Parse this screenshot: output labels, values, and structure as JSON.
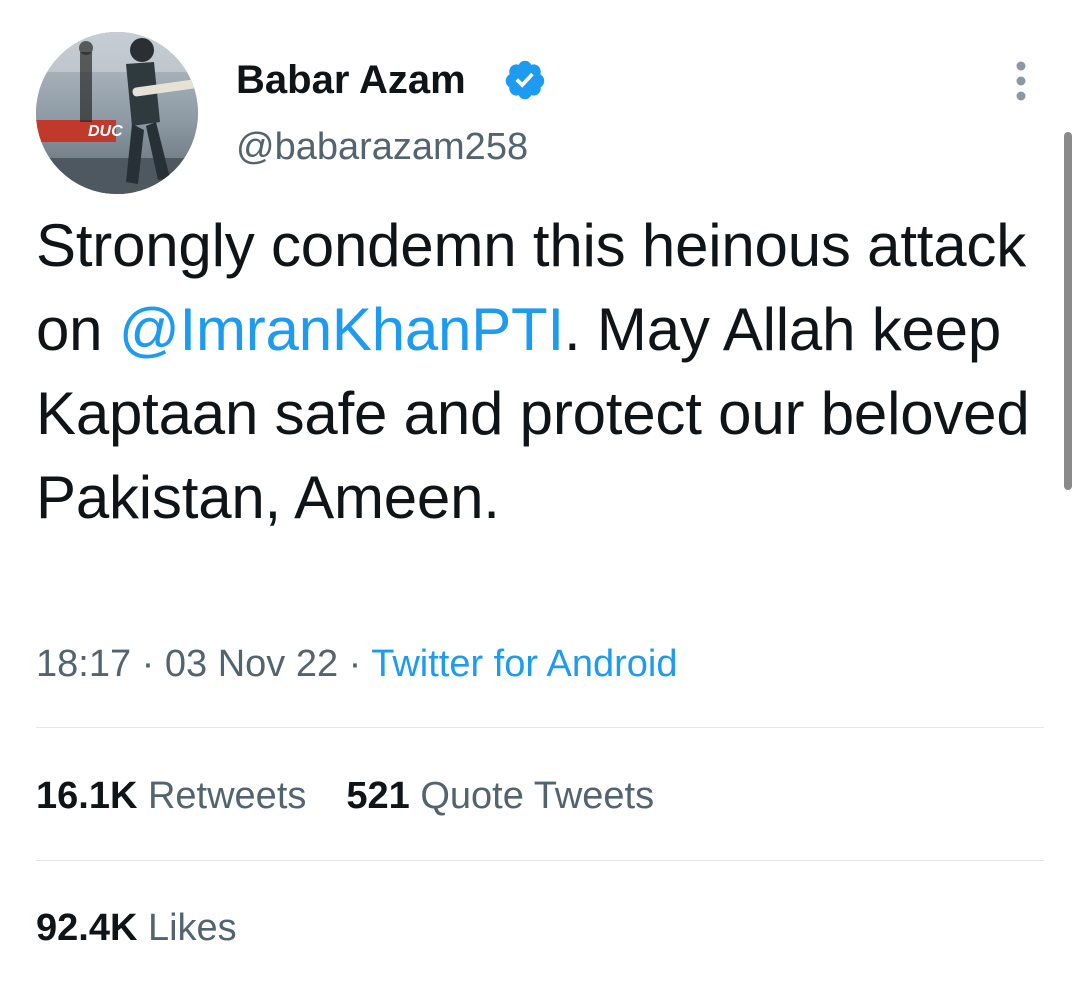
{
  "author": {
    "display_name": "Babar Azam",
    "handle": "@babarazam258",
    "verified": true,
    "avatar_icon": "cricketer-photo-avatar"
  },
  "tweet": {
    "text_part1": "Strongly condemn this heinous attack on ",
    "mention": "@ImranKhanPTI",
    "text_part2": ". May Allah keep Kaptaan safe and protect our beloved Pakistan, Ameen."
  },
  "meta": {
    "time": "18:17",
    "separator": " · ",
    "date": "03 Nov 22",
    "source": "Twitter for Android"
  },
  "stats": {
    "retweets_count": "16.1K",
    "retweets_label": "Retweets",
    "quotes_count": "521",
    "quotes_label": "Quote Tweets",
    "likes_count": "92.4K",
    "likes_label": "Likes"
  },
  "colors": {
    "link": "#1d9bf0",
    "text": "#0f1419",
    "secondary": "#536471",
    "verified_badge": "#1d9bf0"
  }
}
